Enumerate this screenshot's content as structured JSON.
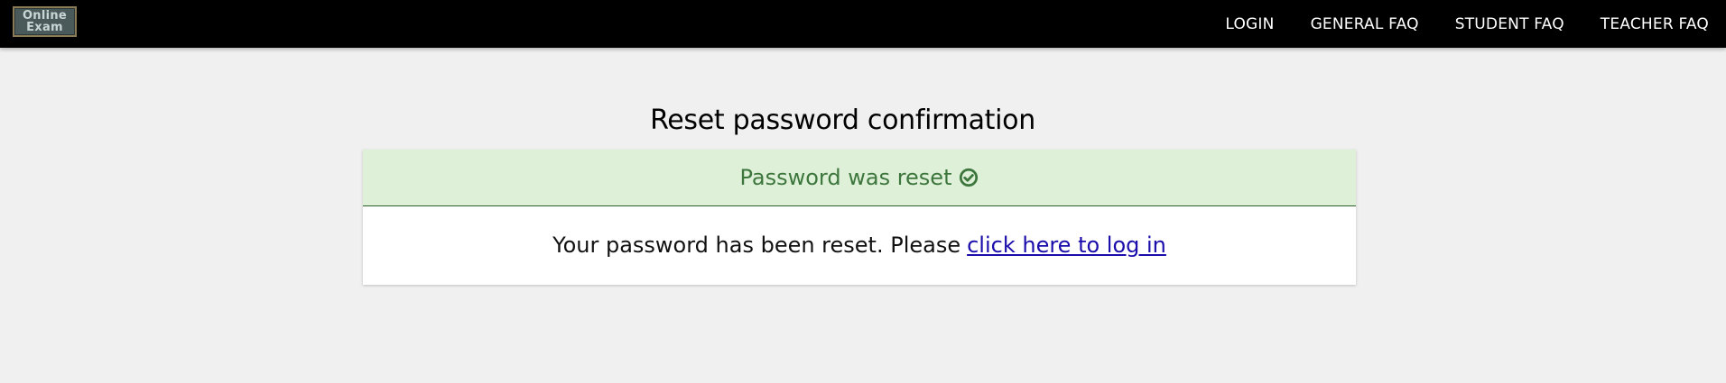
{
  "header": {
    "logo": {
      "line1": "Online",
      "line2": "Exam"
    },
    "nav": [
      {
        "label": "LOGIN"
      },
      {
        "label": "GENERAL FAQ"
      },
      {
        "label": "STUDENT FAQ"
      },
      {
        "label": "TEACHER FAQ"
      }
    ]
  },
  "main": {
    "title": "Reset password confirmation",
    "alert": {
      "heading": "Password was reset",
      "icon": "check-circle-icon",
      "color": "#3c763d",
      "background": "#dff0d8"
    },
    "message": {
      "text": "Your password has been reset. Please",
      "link_text": "click here to log in"
    }
  }
}
